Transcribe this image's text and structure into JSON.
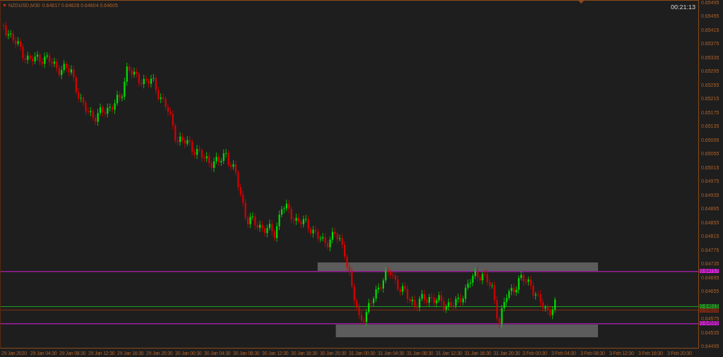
{
  "header": {
    "symbol": "NZDUSD,M30",
    "quotes": "0.64617 0.64628 0.64604 0.64605"
  },
  "timer": "00:21:13",
  "price_axis": [
    "0.65495",
    "0.65455",
    "0.65415",
    "0.65375",
    "0.65335",
    "0.65295",
    "0.65255",
    "0.65215",
    "0.65175",
    "0.65135",
    "0.65095",
    "0.65055",
    "0.65015",
    "0.64975",
    "0.64935",
    "0.64895",
    "0.64855",
    "0.64815",
    "0.64775",
    "0.64735",
    "0.64695",
    "0.64655",
    "0.64575",
    "0.64535",
    "0.64495"
  ],
  "price_levels": [
    {
      "label": "0.64717",
      "color": "#e020e0"
    },
    {
      "label": "0.64615",
      "color": "#20a020"
    },
    {
      "label": "0.64605",
      "color": "#8a2a10"
    },
    {
      "label": "0.64565",
      "color": "#e020e0"
    }
  ],
  "time_axis": [
    "29 Jan 2020",
    "29 Jan 04:30",
    "29 Jan 08:30",
    "29 Jan 12:30",
    "29 Jan 16:30",
    "29 Jan 20:30",
    "30 Jan 00:30",
    "30 Jan 04:30",
    "30 Jan 08:30",
    "30 Jan 12:30",
    "30 Jan 16:30",
    "30 Jan 20:30",
    "31 Jan 00:30",
    "31 Jan 04:30",
    "31 Jan 08:30",
    "31 Jan 12:30",
    "31 Jan 16:30",
    "31 Jan 20:30",
    "3 Feb 00:30",
    "3 Feb 04:30",
    "3 Feb 08:30",
    "3 Feb 12:30",
    "3 Feb 16:30",
    "3 Feb 20:30"
  ]
}
